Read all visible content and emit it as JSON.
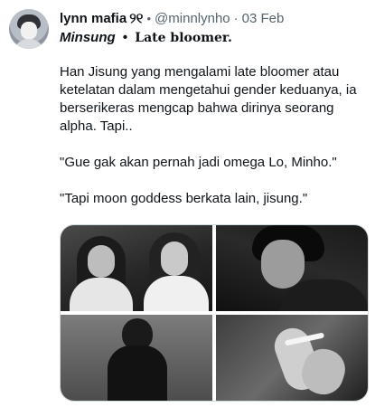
{
  "tweet": {
    "author_name": "lynn mafia",
    "author_emoji": "୨୧",
    "verified_mark": "•",
    "handle": "@minnlynho",
    "separator": "·",
    "date": "03 Feb",
    "title_main": "Minsung",
    "title_dot": "•",
    "title_sub": "Late bloomer.",
    "paragraphs": [
      "Han Jisung yang mengalami late bloomer atau ketelatan dalam mengetahui gender keduanya, ia berserikeras mengcap bahwa dirinya seorang alpha. Tapi..",
      "\"Gue gak akan pernah jadi omega Lo, Minho.\"",
      "\"Tapi moon goddess berkata lain, jisung.\""
    ]
  },
  "media": {
    "count": 4,
    "style": "grayscale photos"
  }
}
